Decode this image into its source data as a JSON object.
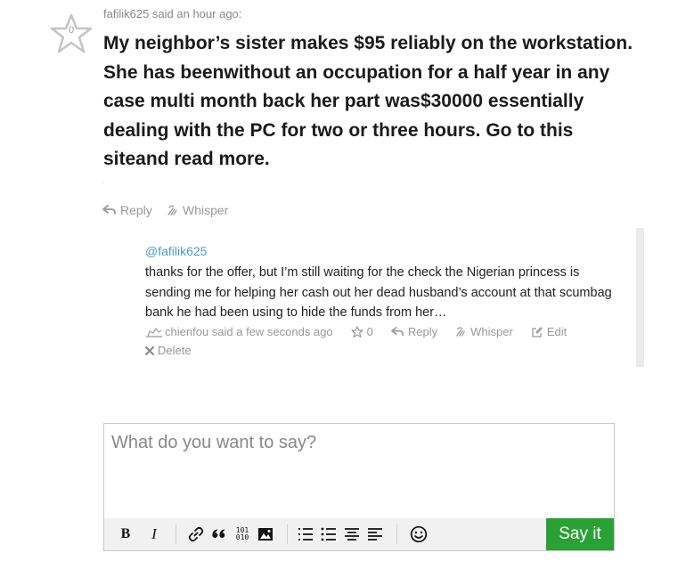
{
  "comment": {
    "author_meta": "fafilik625 said an hour ago:",
    "star_count": "0",
    "body": "My neighbor’s sister makes $95 reliably on the workstation. She has beenwithout an occupation for a half year in any case multi month back her part was$30000 essentially dealing with the PC for two or three hours. Go to this siteand read more.",
    "actions": {
      "reply": "Reply",
      "whisper": "Whisper"
    }
  },
  "reply": {
    "mention": "@fafilik625",
    "body": "thanks for the offer, but I’m still waiting for the check the Nigerian princess is sending me for helping her cash out her dead husband’s account at that scumbag bank he had been using to hide the funds from her…",
    "author_meta": "chienfou said a few seconds ago",
    "star_count": "0",
    "actions": {
      "reply": "Reply",
      "whisper": "Whisper",
      "edit": "Edit",
      "delete": "Delete"
    }
  },
  "composer": {
    "placeholder": "What do you want to say?",
    "submit_label": "Say it",
    "toolbar": {
      "bold": "B",
      "italic": "I",
      "code_label_top": "101",
      "code_label_bottom": "010",
      "icons": [
        "link-icon",
        "quote-icon",
        "code-icon",
        "image-icon",
        "ordered-list-icon",
        "unordered-list-icon",
        "align-center-icon",
        "align-left-icon",
        "emoji-icon"
      ]
    },
    "submit_color": "#2aa135"
  }
}
